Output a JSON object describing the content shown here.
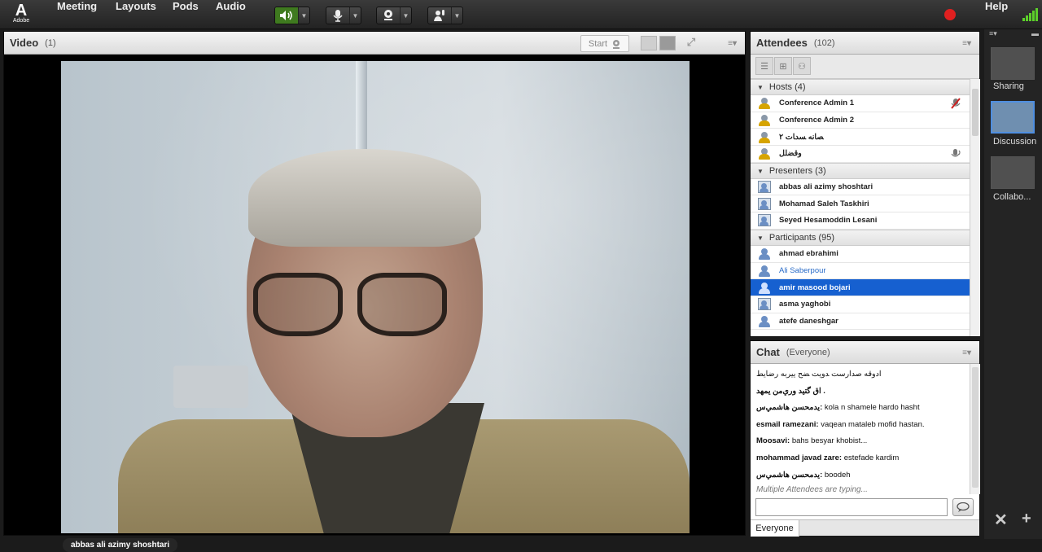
{
  "app": {
    "logo_mark": "A",
    "logo_text": "Adobe"
  },
  "menu": [
    "Meeting",
    "Layouts",
    "Pods",
    "Audio"
  ],
  "help_label": "Help",
  "video": {
    "title": "Video",
    "count": "(1)",
    "start_label": "Start",
    "presenter_name": "abbas ali azimy shoshtari"
  },
  "attendees": {
    "title": "Attendees",
    "count": "(102)",
    "groups": {
      "hosts": {
        "label": "Hosts (4)",
        "items": [
          "Conference Admin 1",
          "Conference Admin 2",
          "ﺼﺎﻧﻪ ﺴﺪﺎﺕ ٢",
          "ﻭﻗﻀﻠﻞ"
        ]
      },
      "presenters": {
        "label": "Presenters (3)",
        "items": [
          "abbas ali azimy shoshtari",
          "Mohamad Saleh Taskhiri",
          "Seyed Hesamoddin Lesani"
        ]
      },
      "participants": {
        "label": "Participants (95)",
        "items": [
          "ahmad ebrahimi",
          "Ali Saberpour",
          "amir masood bojari",
          "asma yaghobi",
          "atefe daneshgar"
        ]
      }
    }
  },
  "chat": {
    "title": "Chat",
    "scope": "(Everyone)",
    "messages": [
      {
        "sender": "",
        "text": "ﺍﺩﻭﻗﻪ ﺻﺪﺍﺭﺳﺖ ﺪﻭﻳﺖ ﻀﺢ ﻳﻴﺮﺑﻪ ﺭﺿﺎﻳﻂ"
      },
      {
        "sender": "",
        "text": ". ﺍﻕ ﮔﺘﻴﺪ ﻭﺭﻱﻣﻦ ﻳﻤﻬﺪ"
      },
      {
        "sender": "ﻳﺪﻣﺤﺴﻦ ﻫﺎﺷﻤﻲﺱ:",
        "text": "kola  n shamele hardo hasht"
      },
      {
        "sender": "esmail ramezani:",
        "text": "vaqean mataleb mofid hastan."
      },
      {
        "sender": "Moosavi:",
        "text": "bahs besyar khobist..."
      },
      {
        "sender": "mohammad javad zare:",
        "text": "estefade kardim"
      },
      {
        "sender": "ﻳﺪﻣﺤﺴﻦ ﻫﺎﺷﻤﻲﺱ:",
        "text": "boodeh"
      }
    ],
    "typing": "Multiple Attendees are typing...",
    "input_value": "",
    "footer_tab": "Everyone"
  },
  "layouts_panel": {
    "items": [
      "Sharing",
      "Discussion",
      "Collabo..."
    ]
  },
  "colors": {
    "accent": "#1660d0",
    "audio_on": "#3f7a1f",
    "record": "#e02020",
    "signal": "#5cd02a"
  }
}
